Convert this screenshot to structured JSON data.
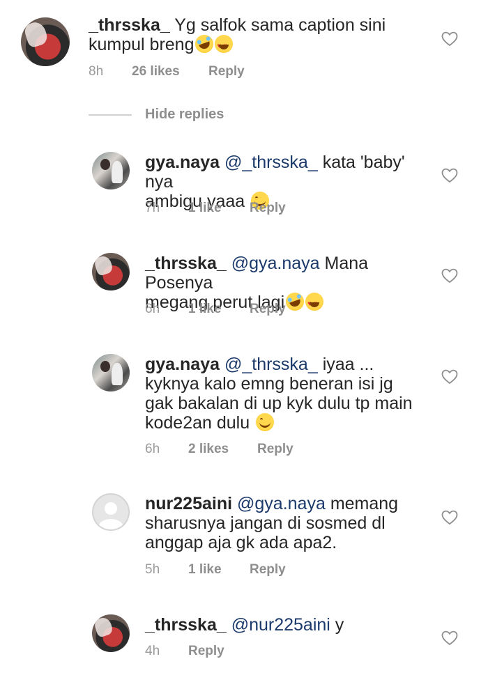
{
  "comments": [
    {
      "username": "_thrsska_",
      "mention": "",
      "text": "Yg salfok sama caption sini",
      "text2": "kumpul breng",
      "time": "8h",
      "likes": "26 likes",
      "reply": "Reply",
      "emojis": [
        "rolling-laugh-emoji",
        "heart-eyes-emoji"
      ]
    },
    {
      "username": "gya.naya",
      "mention": "@_thrsska_",
      "text": "kata 'baby' nya",
      "text2": "ambigu yaaa",
      "time": "7h",
      "likes": "1 like",
      "reply": "Reply",
      "emojis": [
        "smiling-emoji"
      ]
    },
    {
      "username": "_thrsska_",
      "mention": "@gya.naya",
      "text": "Mana Posenya",
      "text2": "megang perut lagi",
      "time": "6h",
      "likes": "1 like",
      "reply": "Reply",
      "emojis": [
        "rolling-laugh-emoji",
        "heart-eyes-emoji"
      ]
    },
    {
      "username": "gya.naya",
      "mention": "@_thrsska_",
      "text": "iyaa ...",
      "text2": "kyknya kalo emng beneran isi jg",
      "text3": "gak bakalan di up kyk dulu tp main",
      "text4": "kode2an dulu",
      "time": "6h",
      "likes": "2 likes",
      "reply": "Reply",
      "emojis": [
        "smiling-emoji"
      ]
    },
    {
      "username": "nur225aini",
      "mention": "@gya.naya",
      "text": "memang",
      "text2": "sharusnya jangan di sosmed dl",
      "text3": "anggap aja gk ada apa2.",
      "time": "5h",
      "likes": "1 like",
      "reply": "Reply"
    },
    {
      "username": "_thrsska_",
      "mention": "@nur225aini",
      "text": "y",
      "time": "4h",
      "likes": "",
      "reply": "Reply"
    }
  ],
  "hide_replies": "Hide replies",
  "colors": {
    "mention": "#1b3a6b",
    "meta": "#8e8e8e",
    "text": "#262626"
  }
}
